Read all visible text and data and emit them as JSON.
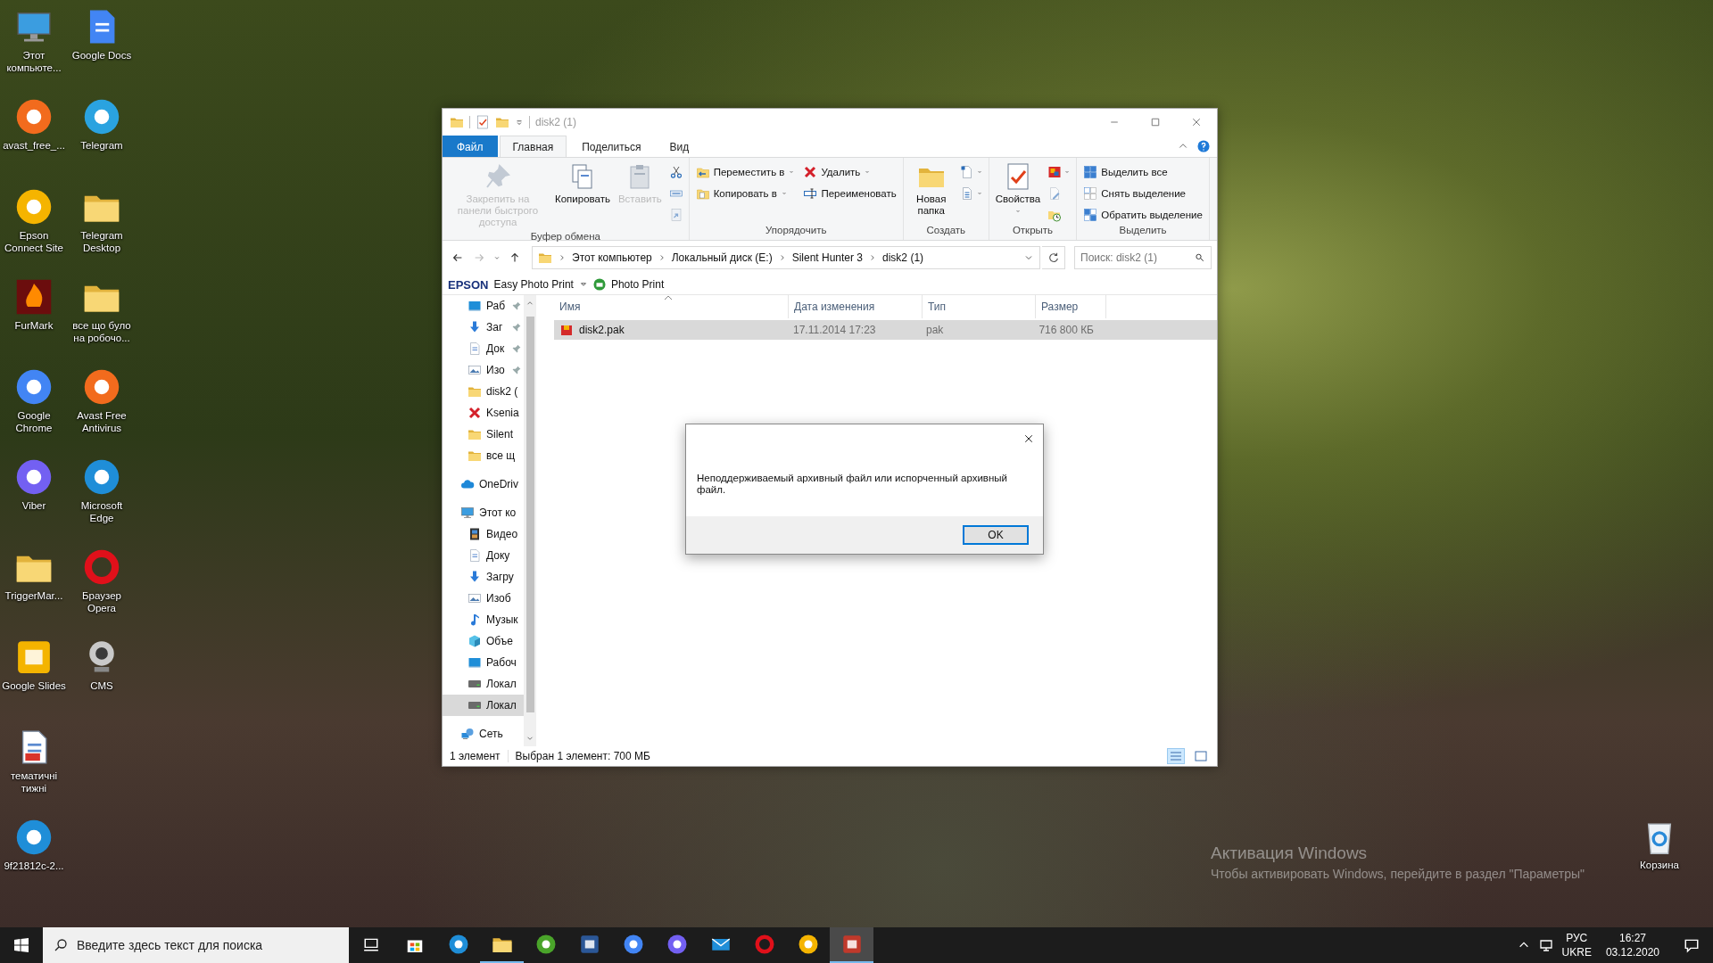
{
  "desktop": {
    "icons": [
      {
        "label": "Этот компьюте..."
      },
      {
        "label": "avast_free_..."
      },
      {
        "label": "Epson Connect Site"
      },
      {
        "label": "FurMark"
      },
      {
        "label": "Google Chrome"
      },
      {
        "label": "Viber"
      },
      {
        "label": "TriggerMar..."
      },
      {
        "label": "Google Slides"
      },
      {
        "label": "тематичні тижні"
      },
      {
        "label": "9f21812c-2..."
      },
      {
        "label": "Google Docs"
      },
      {
        "label": "Telegram"
      },
      {
        "label": "Telegram Desktop"
      },
      {
        "label": "все що було на робочо..."
      },
      {
        "label": "Avast Free Antivirus"
      },
      {
        "label": "Microsoft Edge"
      },
      {
        "label": "Браузер Opera"
      },
      {
        "label": "CMS"
      }
    ],
    "recycle_bin": {
      "label": "Корзина"
    },
    "activation": {
      "title": "Активация Windows",
      "text": "Чтобы активировать Windows, перейдите в раздел \"Параметры\""
    }
  },
  "window": {
    "title": "disk2 (1)",
    "active": false
  },
  "ribbon": {
    "tabs": [
      {
        "label": "Файл",
        "kind": "menu",
        "selected": false
      },
      {
        "label": "Главная",
        "kind": "tab",
        "selected": true
      },
      {
        "label": "Поделиться",
        "kind": "tab",
        "selected": false
      },
      {
        "label": "Вид",
        "kind": "tab",
        "selected": false
      }
    ],
    "groups": [
      {
        "label": "Буфер обмена",
        "columns": [
          [
            {
              "kind": "large",
              "label": "Закрепить на панели быстрого доступа",
              "dropdown": false,
              "disabled": true
            }
          ],
          [
            {
              "kind": "large",
              "label": "Копировать",
              "dropdown": false,
              "disabled": false
            }
          ],
          [
            {
              "kind": "large",
              "label": "Вставить",
              "dropdown": false,
              "disabled": true
            }
          ],
          [
            {
              "kind": "icon",
              "dropdown": false,
              "disabled": false
            },
            {
              "kind": "icon",
              "dropdown": false,
              "disabled": false
            },
            {
              "kind": "icon",
              "dropdown": false,
              "disabled": true
            }
          ]
        ]
      },
      {
        "label": "Упорядочить",
        "columns": [
          [
            {
              "kind": "small",
              "label": "Переместить в",
              "dropdown": true,
              "disabled": false
            },
            {
              "kind": "small",
              "label": "Копировать в",
              "dropdown": true,
              "disabled": false
            }
          ],
          [
            {
              "kind": "small",
              "label": "Удалить",
              "dropdown": true,
              "disabled": false
            },
            {
              "kind": "small",
              "label": "Переименовать",
              "dropdown": false,
              "disabled": false
            }
          ]
        ]
      },
      {
        "label": "Создать",
        "columns": [
          [
            {
              "kind": "large",
              "label": "Новая папка",
              "dropdown": false,
              "disabled": false
            }
          ],
          [
            {
              "kind": "icon",
              "dropdown": true,
              "disabled": false
            },
            {
              "kind": "icon",
              "dropdown": true,
              "disabled": false
            }
          ]
        ]
      },
      {
        "label": "Открыть",
        "columns": [
          [
            {
              "kind": "large",
              "label": "Свойства",
              "dropdown": true,
              "disabled": false
            }
          ],
          [
            {
              "kind": "icon",
              "dropdown": true,
              "disabled": false
            },
            {
              "kind": "icon",
              "dropdown": false,
              "disabled": true
            },
            {
              "kind": "icon",
              "dropdown": false,
              "disabled": false
            }
          ]
        ]
      },
      {
        "label": "Выделить",
        "columns": [
          [
            {
              "kind": "small",
              "label": "Выделить все",
              "dropdown": false,
              "disabled": false
            },
            {
              "kind": "small",
              "label": "Снять выделение",
              "dropdown": false,
              "disabled": false
            },
            {
              "kind": "small",
              "label": "Обратить выделение",
              "dropdown": false,
              "disabled": false
            }
          ]
        ]
      }
    ]
  },
  "navigation": {
    "back_disabled": false,
    "forward_disabled": true
  },
  "address": {
    "crumbs": [
      "Этот компьютер",
      "Локальный диск (E:)",
      "Silent Hunter 3",
      "disk2 (1)"
    ]
  },
  "search": {
    "placeholder": "Поиск: disk2 (1)"
  },
  "epson_bar": {
    "brand": "EPSON",
    "app": "Easy Photo Print",
    "print": "Photo Print"
  },
  "nav_pane": {
    "quick_access": [
      {
        "label": "Раб",
        "pinned": true
      },
      {
        "label": "Заг",
        "pinned": true
      },
      {
        "label": "Док",
        "pinned": true
      },
      {
        "label": "Изо",
        "pinned": true
      },
      {
        "label": "disk2 (",
        "pinned": false
      },
      {
        "label": "Ksenia",
        "pinned": false
      },
      {
        "label": "Silent",
        "pinned": false
      },
      {
        "label": "все щ",
        "pinned": false
      }
    ],
    "onedrive": {
      "label": "OneDriv"
    },
    "this_pc": {
      "label": "Этот ко",
      "children": [
        {
          "label": "Видео",
          "selected": false
        },
        {
          "label": "Доку",
          "selected": false
        },
        {
          "label": "Загру",
          "selected": false
        },
        {
          "label": "Изоб",
          "selected": false
        },
        {
          "label": "Музык",
          "selected": false
        },
        {
          "label": "Объе",
          "selected": false
        },
        {
          "label": "Рабоч",
          "selected": false
        },
        {
          "label": "Локал",
          "selected": false
        },
        {
          "label": "Локал",
          "selected": true
        }
      ]
    },
    "network": {
      "label": "Сеть"
    }
  },
  "file_list": {
    "columns": [
      {
        "label": "Имя",
        "sorted": true
      },
      {
        "label": "Дата изменения",
        "sorted": false
      },
      {
        "label": "Тип",
        "sorted": false
      },
      {
        "label": "Размер",
        "sorted": false
      }
    ],
    "rows": [
      {
        "name": "disk2.pak",
        "modified": "17.11.2014 17:23",
        "type": "pak",
        "size": "716 800 КБ",
        "selected": true
      }
    ]
  },
  "status_bar": {
    "count": "1 элемент",
    "selection": "Выбран 1 элемент: 700 МБ",
    "views": [
      {
        "kind": "details",
        "selected": true
      },
      {
        "kind": "tiles",
        "selected": false
      }
    ]
  },
  "dialog": {
    "message": "Неподдерживаемый архивный файл или испорченный архивный файл.",
    "button": "OK"
  },
  "taskbar": {
    "search": {
      "placeholder": "Введите здесь текст для поиска"
    },
    "apps": [
      {
        "running": false,
        "selected": false
      },
      {
        "running": false,
        "selected": false
      },
      {
        "running": true,
        "selected": false
      },
      {
        "running": false,
        "selected": false
      },
      {
        "running": false,
        "selected": false
      },
      {
        "running": false,
        "selected": false
      },
      {
        "running": false,
        "selected": false
      },
      {
        "running": false,
        "selected": false
      },
      {
        "running": false,
        "selected": false
      },
      {
        "running": false,
        "selected": false
      },
      {
        "running": true,
        "selected": true
      }
    ],
    "tray": {
      "language": "РУС",
      "layout": "UKRE",
      "time": "16:27",
      "date": "03.12.2020"
    }
  }
}
